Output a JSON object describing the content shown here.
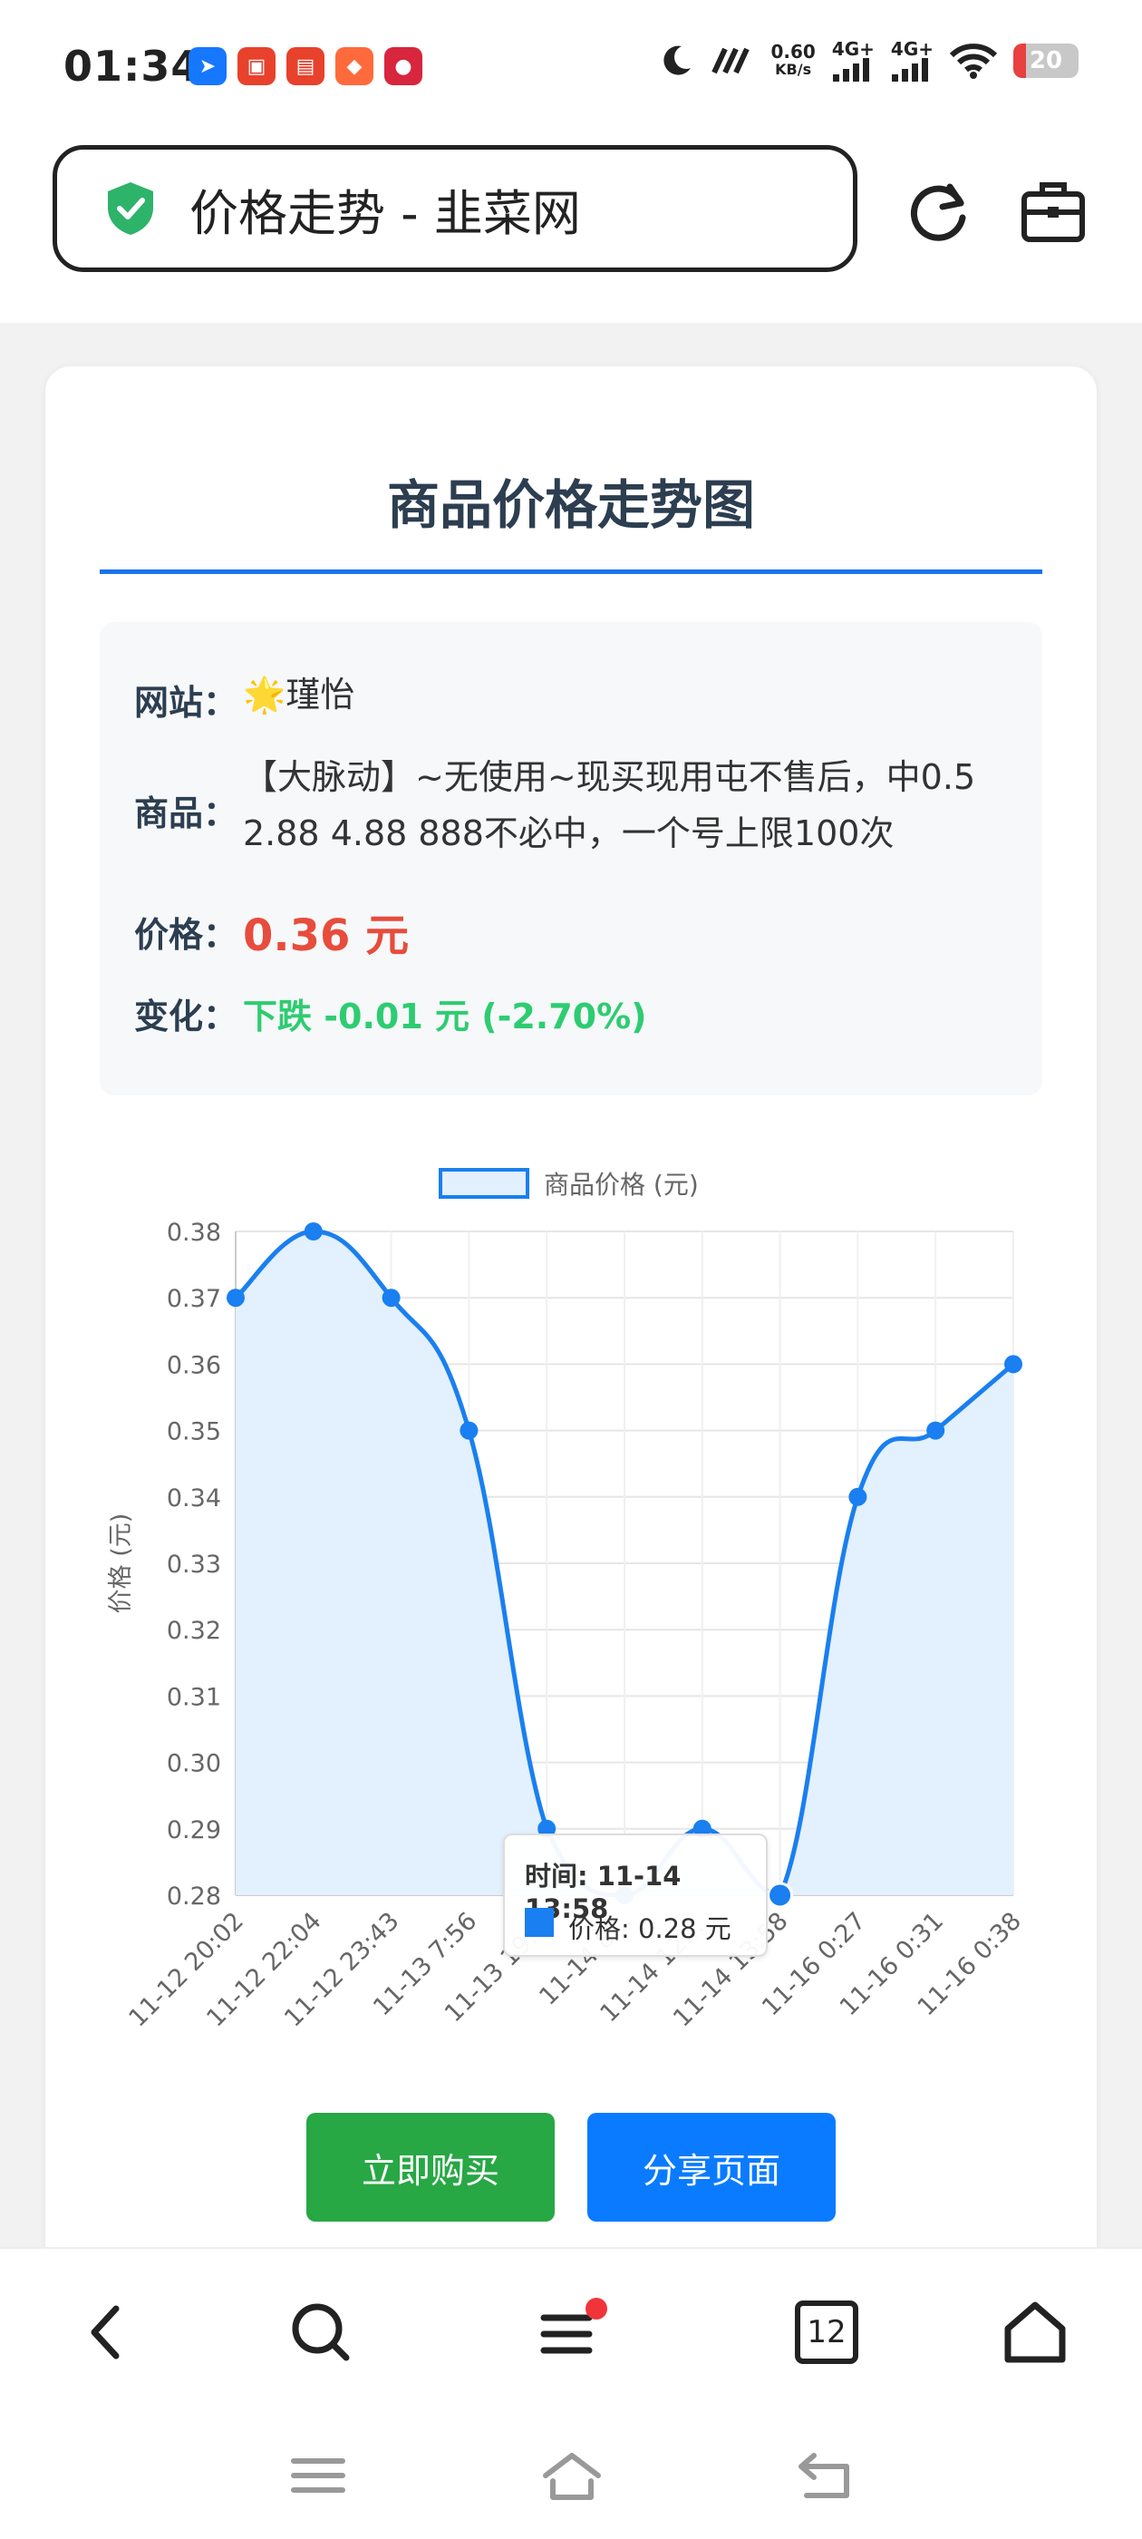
{
  "status_bar": {
    "time": "01:34",
    "net_speed_value": "0.60",
    "net_speed_unit": "KB/s",
    "sim1": "4G+",
    "sim2": "4G+",
    "battery": "20"
  },
  "url_bar": {
    "title": "价格走势 - 韭菜网"
  },
  "card": {
    "title": "商品价格走势图",
    "info": {
      "site_label": "网站：",
      "site_value": "🌟瑾怡",
      "product_label": "商品：",
      "product_line1": "【大脉动】~无使用~现买现用屯不售后，中0.5",
      "product_line2": "2.88 4.88 888不必中，一个号上限100次",
      "price_label": "价格：",
      "price_value": "0.36 元",
      "change_label": "变化：",
      "change_value": "下跌 -0.01 元 (-2.70%)"
    }
  },
  "chart_data": {
    "type": "line",
    "categories": [
      "11-12 20:02",
      "11-12 22:04",
      "11-12 23:43",
      "11-13 7:56",
      "11-13 19:…",
      "11-14 8…",
      "11-14 12:…",
      "11-14 13:58",
      "11-16 0:27",
      "11-16 0:31",
      "11-16 0:38"
    ],
    "series": [
      {
        "name": "商品价格 (元)",
        "values": [
          0.37,
          0.38,
          0.37,
          0.35,
          0.29,
          0.28,
          0.29,
          0.28,
          0.34,
          0.35,
          0.36
        ]
      }
    ],
    "ylabel": "价格 (元)",
    "ylim": [
      0.28,
      0.38
    ],
    "yticks": [
      "0.38",
      "0.37",
      "0.36",
      "0.35",
      "0.34",
      "0.33",
      "0.32",
      "0.31",
      "0.30",
      "0.29",
      "0.28"
    ],
    "grid": true,
    "legend": "top",
    "line_color": "#1a7ff0",
    "fill_color": "#e3f0fd"
  },
  "tooltip": {
    "title": "时间: 11-14 13:58",
    "body": "价格: 0.28 元"
  },
  "buttons": {
    "buy": "立即购买",
    "share": "分享页面"
  },
  "bottom_nav": {
    "tabs_count": "12"
  }
}
